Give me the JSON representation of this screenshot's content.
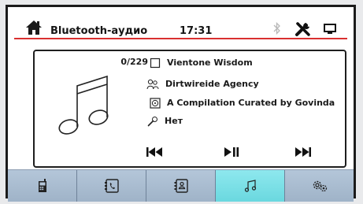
{
  "header": {
    "title": "Bluetooth-аудио",
    "time": "17:31",
    "accent_color": "#d93030"
  },
  "player": {
    "track_count": "0/229",
    "song": "Vientone Wisdom",
    "artist": "Dirtwireide Agency",
    "album": "A Compilation Curated by Govinda",
    "genre": "Нет"
  },
  "icons": {
    "home": "home-icon",
    "bluetooth": "bluetooth-icon",
    "settings": "tools-icon",
    "display": "screen-icon",
    "song": "checkbox-icon",
    "artist": "person-icon",
    "album": "disc-icon",
    "genre": "microphone-icon",
    "prev": "skip-previous-icon",
    "play_pause": "play-pause-icon",
    "next": "skip-next-icon"
  },
  "tabs": [
    {
      "icon": "phone-icon",
      "active": false
    },
    {
      "icon": "call-log-icon",
      "active": false
    },
    {
      "icon": "contacts-icon",
      "active": false
    },
    {
      "icon": "music-icon",
      "active": true
    },
    {
      "icon": "settings-icon",
      "active": false
    }
  ],
  "colors": {
    "tab_bg": "#a9bdd1",
    "tab_active": "#7ee0e6"
  }
}
